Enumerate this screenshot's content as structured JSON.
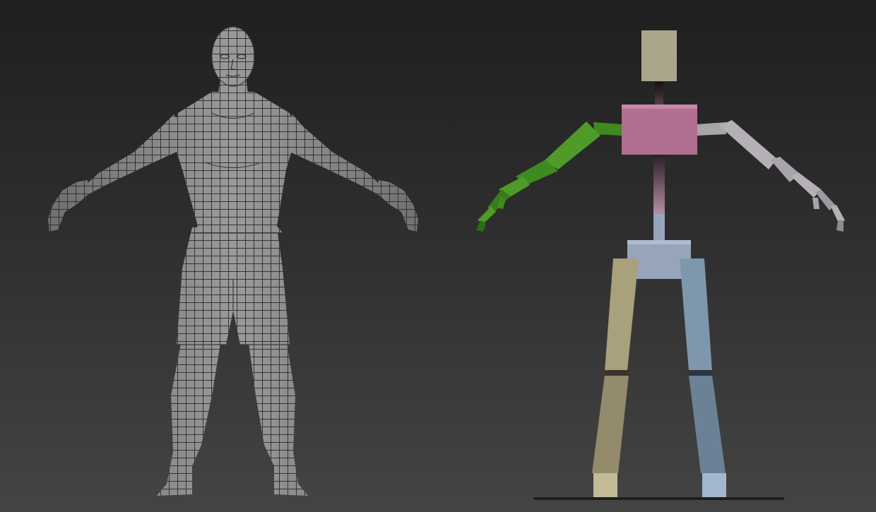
{
  "viewport": {
    "background_top": "#1f1f1f",
    "background_bottom": "#444444"
  },
  "models": [
    {
      "id": "mesh",
      "kind": "wireframe-human-mesh",
      "surface_color": "#8a8a8a",
      "wire_color": "#2a2a2a"
    },
    {
      "id": "biped",
      "kind": "biped-skeleton-rig",
      "parts": {
        "head": "#aaa68c",
        "neck": "#2a2a2a",
        "chest": "#b06f90",
        "spine": "#7e6274",
        "pelvis": "#97a5bb",
        "left_arm": "#4f9a28",
        "right_arm": "#a8a4aa",
        "left_leg": "#a9a07c",
        "right_leg": "#7f97ad",
        "ground": "#1e1e1e"
      }
    }
  ]
}
